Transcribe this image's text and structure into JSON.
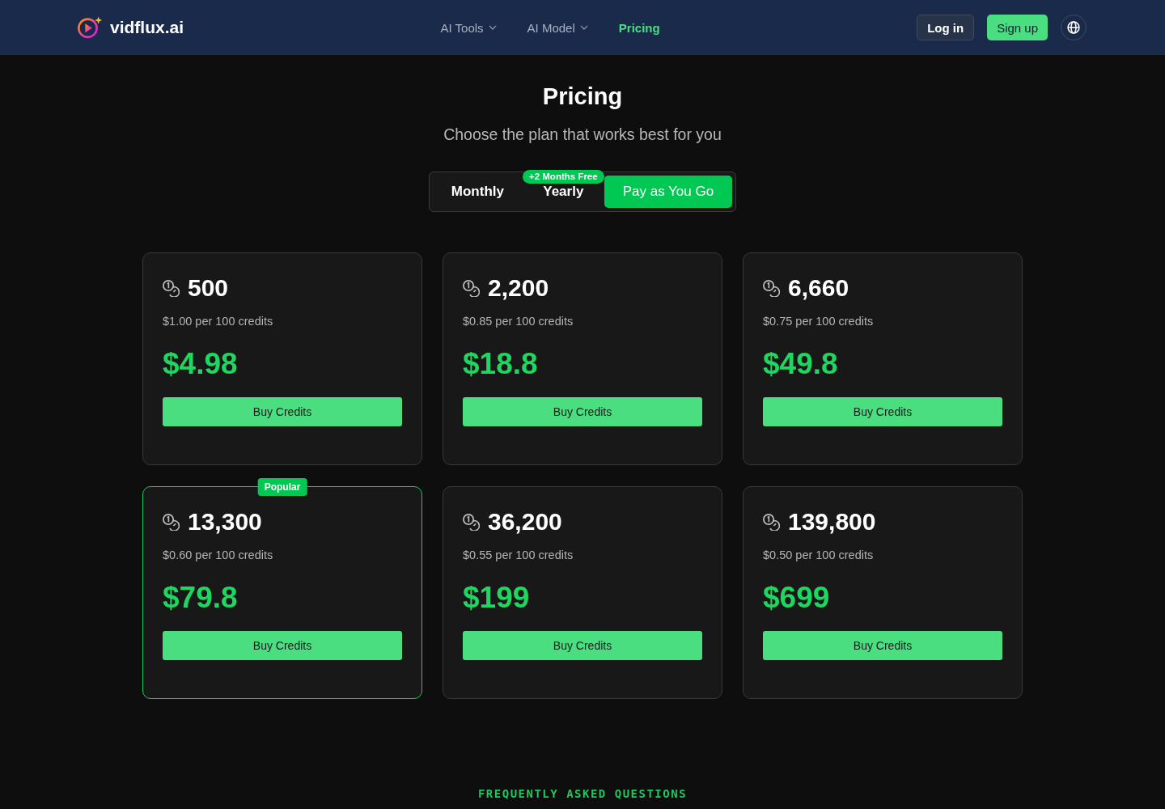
{
  "header": {
    "logo": {
      "text": "vidflux.ai"
    },
    "nav": [
      {
        "label": "AI Tools",
        "dropdown": true,
        "selected": false
      },
      {
        "label": "AI Model",
        "dropdown": true,
        "selected": false
      },
      {
        "label": "Pricing",
        "dropdown": false,
        "selected": true
      }
    ],
    "login_button": "Log in",
    "signup_button": "Sign up"
  },
  "hero": {
    "title": "Pricing",
    "subtitle": "Choose the plan that works best for you"
  },
  "billing_tabs": [
    {
      "label": "Monthly",
      "selected": false
    },
    {
      "label": "Yearly",
      "selected": false,
      "badge": "+2 Months Free"
    },
    {
      "label": "Pay as You Go",
      "selected": true
    }
  ],
  "plans": [
    {
      "credits": "500",
      "rate": "$1.00 per 100 credits",
      "price": "$4.98",
      "button": "Buy Credits",
      "highlighted": false
    },
    {
      "credits": "2,200",
      "rate": "$0.85 per 100 credits",
      "price": "$18.8",
      "button": "Buy Credits",
      "highlighted": false
    },
    {
      "credits": "6,660",
      "rate": "$0.75 per 100 credits",
      "price": "$49.8",
      "button": "Buy Credits",
      "highlighted": false
    },
    {
      "credits": "13,300",
      "rate": "$0.60 per 100 credits",
      "price": "$79.8",
      "button": "Buy Credits",
      "highlighted": true,
      "badge": "Popular"
    },
    {
      "credits": "36,200",
      "rate": "$0.55 per 100 credits",
      "price": "$199",
      "button": "Buy Credits",
      "highlighted": false
    },
    {
      "credits": "139,800",
      "rate": "$0.50 per 100 credits",
      "price": "$699",
      "button": "Buy Credits",
      "highlighted": false
    }
  ],
  "faq": {
    "heading": "FREQUENTLY ASKED QUESTIONS"
  }
}
